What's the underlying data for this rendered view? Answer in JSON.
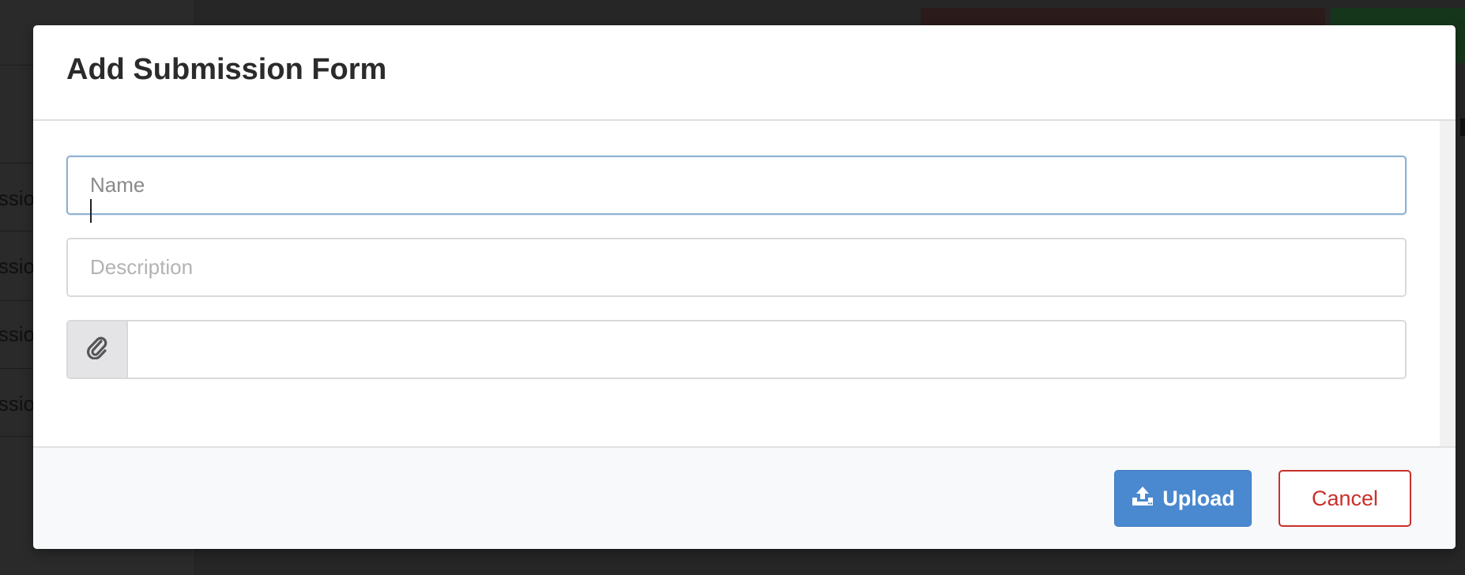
{
  "background": {
    "row_fragments": [
      "ssio",
      "ssio",
      "ssio",
      "ssio"
    ]
  },
  "modal": {
    "title": "Add Submission Form",
    "name_field": {
      "placeholder": "Name",
      "value": ""
    },
    "description_field": {
      "placeholder": "Description",
      "value": ""
    },
    "file_field": {
      "icon": "paperclip-icon",
      "value": ""
    },
    "footer": {
      "upload_label": "Upload",
      "upload_icon": "upload-icon",
      "cancel_label": "Cancel"
    }
  },
  "colors": {
    "primary": "#4a89d0",
    "danger": "#c9302c",
    "overlay": "#262626",
    "focus_border": "#8fb2d2"
  }
}
